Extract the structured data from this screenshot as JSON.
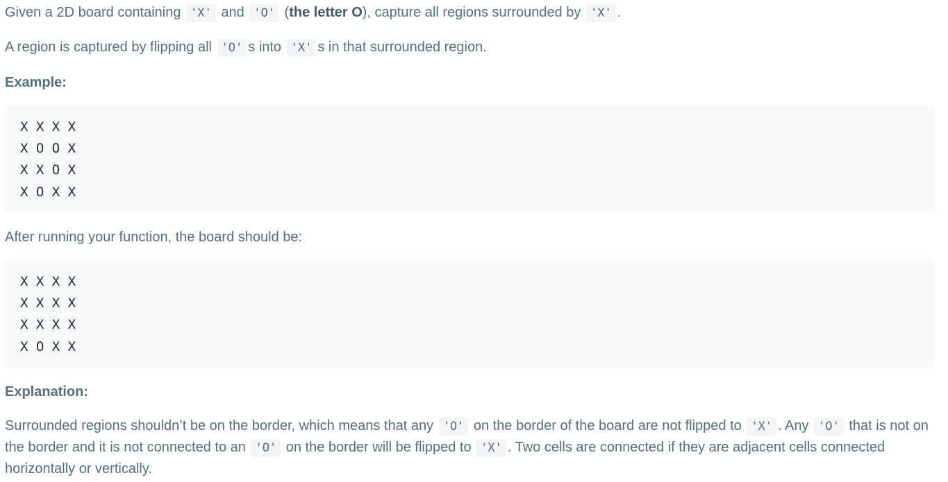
{
  "intro": {
    "t1": "Given a 2D board containing ",
    "code_x": "'X'",
    "t2": " and ",
    "code_o": "'O'",
    "t3": " (",
    "bold": "the letter O",
    "t4": "), capture all regions surrounded by ",
    "code_x2": "'X'",
    "t5": "."
  },
  "capture_desc": {
    "t1": "A region is captured by flipping all ",
    "code_o": "'O'",
    "t2": "s into ",
    "code_x": "'X'",
    "t3": "s in that surrounded region."
  },
  "example_heading": "Example:",
  "before_board": [
    "X X X X",
    "X O O X",
    "X X O X",
    "X O X X"
  ],
  "after_label": "After running your function, the board should be:",
  "after_board": [
    "X X X X",
    "X X X X",
    "X X X X",
    "X O X X"
  ],
  "explanation_heading": "Explanation:",
  "explanation": {
    "t1": "Surrounded regions shouldn’t be on the border, which means that any ",
    "code_o1": "'O'",
    "t2": " on the border of the board are not flipped to ",
    "code_x1": "'X'",
    "t3": ". Any ",
    "code_o2": "'O'",
    "t4": " that is not on the border and it is not connected to an ",
    "code_o3": "'O'",
    "t5": " on the border will be flipped to ",
    "code_x2": "'X'",
    "t6": ". Two cells are connected if they are adjacent cells connected horizontally or vertically."
  }
}
